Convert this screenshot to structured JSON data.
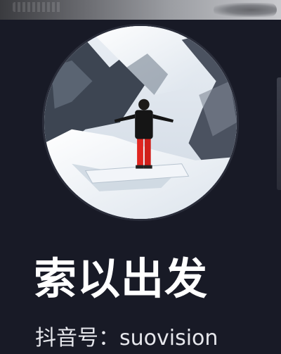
{
  "profile": {
    "display_name": "索以出发",
    "douyin_id": "抖音号：suovision",
    "avatar_icon": "avatar-photo-skier-on-snow"
  },
  "colors": {
    "background": "#181a26",
    "name_text": "#ffffff",
    "id_text": "#e6e7ec"
  }
}
